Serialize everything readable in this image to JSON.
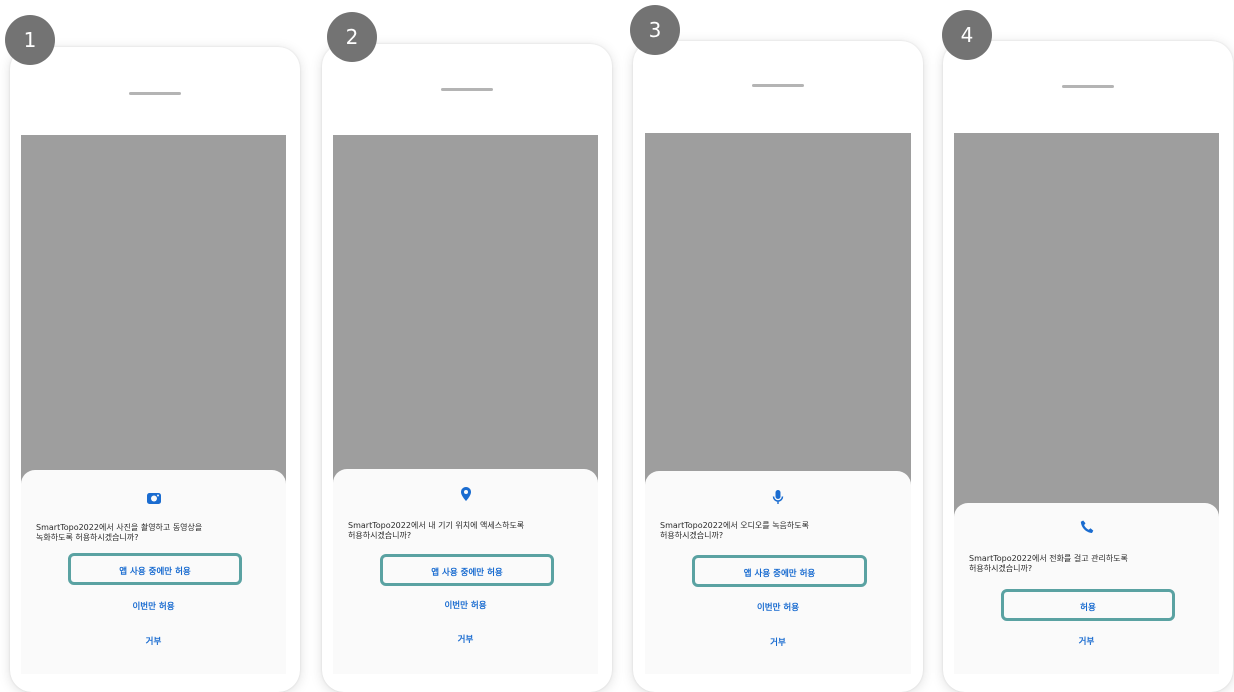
{
  "accent_color": "#1a6cd0",
  "highlight_color": "#5aa2a2",
  "panels": [
    {
      "step": "1",
      "icon": "camera-icon",
      "prompt": "SmartTopo2022에서 사진을 촬영하고 동영상을\n녹화하도록 허용하시겠습니까?",
      "options": [
        "앱 사용 중에만 허용",
        "이번만 허용",
        "거부"
      ],
      "highlighted_option": "앱 사용 중에만 허용"
    },
    {
      "step": "2",
      "icon": "location-pin-icon",
      "prompt": "SmartTopo2022에서 내 기기 위치에 액세스하도록\n허용하시겠습니까?",
      "options": [
        "앱 사용 중에만 허용",
        "이번만 허용",
        "거부"
      ],
      "highlighted_option": "앱 사용 중에만 허용"
    },
    {
      "step": "3",
      "icon": "microphone-icon",
      "prompt": "SmartTopo2022에서 오디오를 녹음하도록\n허용하시겠습니까?",
      "options": [
        "앱 사용 중에만 허용",
        "이번만 허용",
        "거부"
      ],
      "highlighted_option": "앱 사용 중에만 허용"
    },
    {
      "step": "4",
      "icon": "phone-icon",
      "prompt": "SmartTopo2022에서 전화를 걸고 관리하도록\n허용하시겠습니까?",
      "options": [
        "허용",
        "거부"
      ],
      "highlighted_option": "허용"
    }
  ]
}
